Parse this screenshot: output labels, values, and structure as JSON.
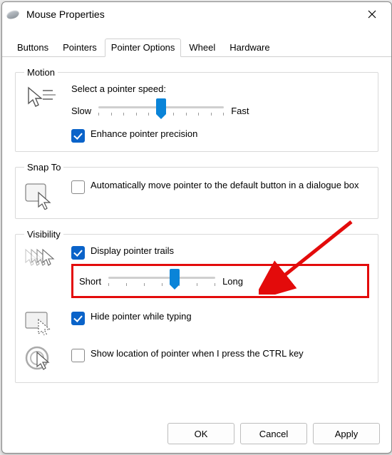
{
  "window": {
    "title": "Mouse Properties"
  },
  "tabs": {
    "items": [
      "Buttons",
      "Pointers",
      "Pointer Options",
      "Wheel",
      "Hardware"
    ],
    "active": 2
  },
  "motion": {
    "legend": "Motion",
    "select_label": "Select a pointer speed:",
    "slow": "Slow",
    "fast": "Fast",
    "slider_pos_pct": 50,
    "enhance_label": "Enhance pointer precision",
    "enhance_checked": true
  },
  "snapto": {
    "legend": "Snap To",
    "auto_label": "Automatically move pointer to the default button in a dialogue box",
    "auto_checked": false
  },
  "visibility": {
    "legend": "Visibility",
    "trails_label": "Display pointer trails",
    "trails_checked": true,
    "trails_short": "Short",
    "trails_long": "Long",
    "trails_slider_pos_pct": 62,
    "hide_label": "Hide pointer while typing",
    "hide_checked": true,
    "ctrl_label": "Show location of pointer when I press the CTRL key",
    "ctrl_checked": false
  },
  "buttons": {
    "ok": "OK",
    "cancel": "Cancel",
    "apply": "Apply"
  }
}
